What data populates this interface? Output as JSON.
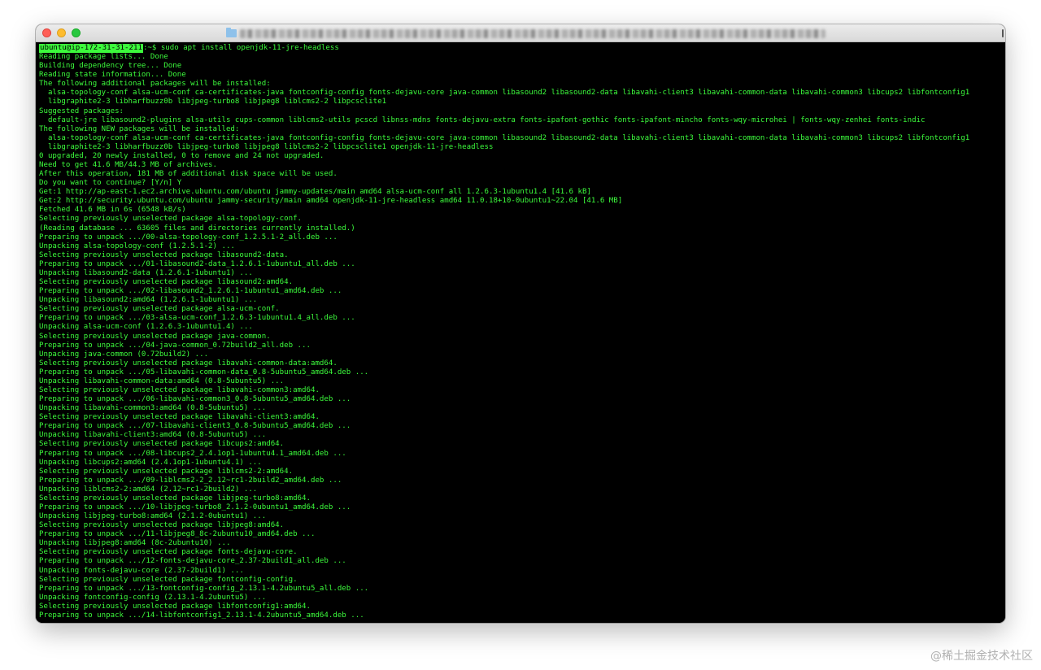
{
  "window": {
    "title": "",
    "controls": {
      "close": "close-button",
      "minimize": "minimize-button",
      "maximize": "maximize-button"
    },
    "folder_icon": "folder-icon"
  },
  "terminal": {
    "prompt_user": "ubuntu@ip-172-31-31-211",
    "prompt_rest": ":~$ sudo apt install openjdk-11-jre-headless",
    "lines": [
      "Reading package lists... Done",
      "Building dependency tree... Done",
      "Reading state information... Done",
      "The following additional packages will be installed:",
      "  alsa-topology-conf alsa-ucm-conf ca-certificates-java fontconfig-config fonts-dejavu-core java-common libasound2 libasound2-data libavahi-client3 libavahi-common-data libavahi-common3 libcups2 libfontconfig1",
      "  libgraphite2-3 libharfbuzz0b libjpeg-turbo8 libjpeg8 liblcms2-2 libpcsclite1",
      "Suggested packages:",
      "  default-jre libasound2-plugins alsa-utils cups-common liblcms2-utils pcscd libnss-mdns fonts-dejavu-extra fonts-ipafont-gothic fonts-ipafont-mincho fonts-wqy-microhei | fonts-wqy-zenhei fonts-indic",
      "The following NEW packages will be installed:",
      "  alsa-topology-conf alsa-ucm-conf ca-certificates-java fontconfig-config fonts-dejavu-core java-common libasound2 libasound2-data libavahi-client3 libavahi-common-data libavahi-common3 libcups2 libfontconfig1",
      "  libgraphite2-3 libharfbuzz0b libjpeg-turbo8 libjpeg8 liblcms2-2 libpcsclite1 openjdk-11-jre-headless",
      "0 upgraded, 20 newly installed, 0 to remove and 24 not upgraded.",
      "Need to get 41.6 MB/44.3 MB of archives.",
      "After this operation, 181 MB of additional disk space will be used.",
      "Do you want to continue? [Y/n] Y",
      "Get:1 http://ap-east-1.ec2.archive.ubuntu.com/ubuntu jammy-updates/main amd64 alsa-ucm-conf all 1.2.6.3-1ubuntu1.4 [41.6 kB]",
      "Get:2 http://security.ubuntu.com/ubuntu jammy-security/main amd64 openjdk-11-jre-headless amd64 11.0.18+10-0ubuntu1~22.04 [41.6 MB]",
      "Fetched 41.6 MB in 6s (6548 kB/s)",
      "Selecting previously unselected package alsa-topology-conf.",
      "(Reading database ... 63605 files and directories currently installed.)",
      "Preparing to unpack .../00-alsa-topology-conf_1.2.5.1-2_all.deb ...",
      "Unpacking alsa-topology-conf (1.2.5.1-2) ...",
      "Selecting previously unselected package libasound2-data.",
      "Preparing to unpack .../01-libasound2-data_1.2.6.1-1ubuntu1_all.deb ...",
      "Unpacking libasound2-data (1.2.6.1-1ubuntu1) ...",
      "Selecting previously unselected package libasound2:amd64.",
      "Preparing to unpack .../02-libasound2_1.2.6.1-1ubuntu1_amd64.deb ...",
      "Unpacking libasound2:amd64 (1.2.6.1-1ubuntu1) ...",
      "Selecting previously unselected package alsa-ucm-conf.",
      "Preparing to unpack .../03-alsa-ucm-conf_1.2.6.3-1ubuntu1.4_all.deb ...",
      "Unpacking alsa-ucm-conf (1.2.6.3-1ubuntu1.4) ...",
      "Selecting previously unselected package java-common.",
      "Preparing to unpack .../04-java-common_0.72build2_all.deb ...",
      "Unpacking java-common (0.72build2) ...",
      "Selecting previously unselected package libavahi-common-data:amd64.",
      "Preparing to unpack .../05-libavahi-common-data_0.8-5ubuntu5_amd64.deb ...",
      "Unpacking libavahi-common-data:amd64 (0.8-5ubuntu5) ...",
      "Selecting previously unselected package libavahi-common3:amd64.",
      "Preparing to unpack .../06-libavahi-common3_0.8-5ubuntu5_amd64.deb ...",
      "Unpacking libavahi-common3:amd64 (0.8-5ubuntu5) ...",
      "Selecting previously unselected package libavahi-client3:amd64.",
      "Preparing to unpack .../07-libavahi-client3_0.8-5ubuntu5_amd64.deb ...",
      "Unpacking libavahi-client3:amd64 (0.8-5ubuntu5) ...",
      "Selecting previously unselected package libcups2:amd64.",
      "Preparing to unpack .../08-libcups2_2.4.1op1-1ubuntu4.1_amd64.deb ...",
      "Unpacking libcups2:amd64 (2.4.1op1-1ubuntu4.1) ...",
      "Selecting previously unselected package liblcms2-2:amd64.",
      "Preparing to unpack .../09-liblcms2-2_2.12~rc1-2build2_amd64.deb ...",
      "Unpacking liblcms2-2:amd64 (2.12~rc1-2build2) ...",
      "Selecting previously unselected package libjpeg-turbo8:amd64.",
      "Preparing to unpack .../10-libjpeg-turbo8_2.1.2-0ubuntu1_amd64.deb ...",
      "Unpacking libjpeg-turbo8:amd64 (2.1.2-0ubuntu1) ...",
      "Selecting previously unselected package libjpeg8:amd64.",
      "Preparing to unpack .../11-libjpeg8_8c-2ubuntu10_amd64.deb ...",
      "Unpacking libjpeg8:amd64 (8c-2ubuntu10) ...",
      "Selecting previously unselected package fonts-dejavu-core.",
      "Preparing to unpack .../12-fonts-dejavu-core_2.37-2build1_all.deb ...",
      "Unpacking fonts-dejavu-core (2.37-2build1) ...",
      "Selecting previously unselected package fontconfig-config.",
      "Preparing to unpack .../13-fontconfig-config_2.13.1-4.2ubuntu5_all.deb ...",
      "Unpacking fontconfig-config (2.13.1-4.2ubuntu5) ...",
      "Selecting previously unselected package libfontconfig1:amd64.",
      "Preparing to unpack .../14-libfontconfig1_2.13.1-4.2ubuntu5_amd64.deb ..."
    ]
  },
  "watermark": "@稀土掘金技术社区",
  "colors": {
    "terminal_bg": "#000000",
    "terminal_fg": "#3cfb3c",
    "titlebar": "#e3e3e3",
    "close": "#ff5f57",
    "minimize": "#febc2e",
    "maximize": "#28c840"
  }
}
